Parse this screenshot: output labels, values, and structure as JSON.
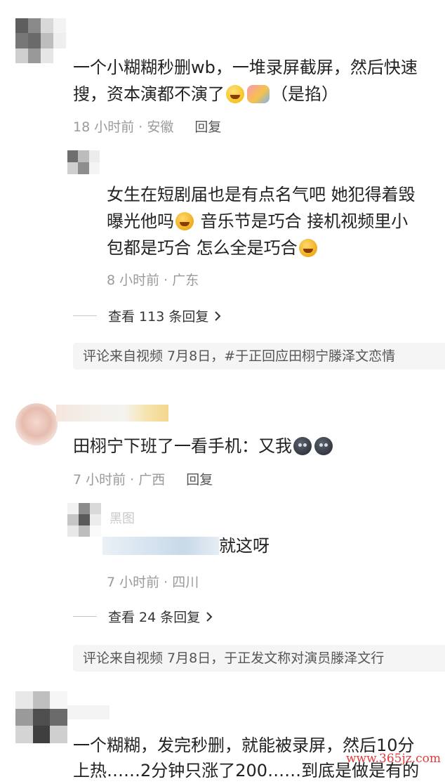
{
  "comments": [
    {
      "text_line1": "一个小糊糊秒删wb，一堆录屏截屏，然后快速",
      "text_line2": "搜，资本演都不演了",
      "text_line2_tail": "（是掐）",
      "time": "18 小时前",
      "location": "安徽",
      "reply_label": "回复",
      "sub_reply": {
        "line1": "女生在短剧届也是有点名气吧 她犯得着毁",
        "line2a": "曝光他吗",
        "line2b": " 音乐节是巧合 接机视频里小",
        "line3": "包都是巧合 怎么全是巧合",
        "time": "8 小时前",
        "location": "广东"
      },
      "view_more": "查看 113 条回复",
      "source": "评论来自视频 7月8日，#于正回应田栩宁滕泽文恋情"
    },
    {
      "text": "田栩宁下班了一看手机：又我",
      "time": "7 小时前",
      "location": "广西",
      "reply_label": "回复",
      "sub_reply": {
        "name_fragment": "黑图",
        "text": "就这呀",
        "time": "7 小时前",
        "location": "四川"
      },
      "view_more": "查看 24 条回复",
      "source": "评论来自视频 7月8日，于正发文称对演员滕泽文行"
    },
    {
      "text_line1": "一个糊糊，发完秒删，就能被录屏，然后10分",
      "text_line2": "上热……2分钟只涨了200……到底是做是有的"
    }
  ],
  "watermark": "www.365jz.com",
  "icons": {
    "chevron": "chevron-right-icon"
  }
}
